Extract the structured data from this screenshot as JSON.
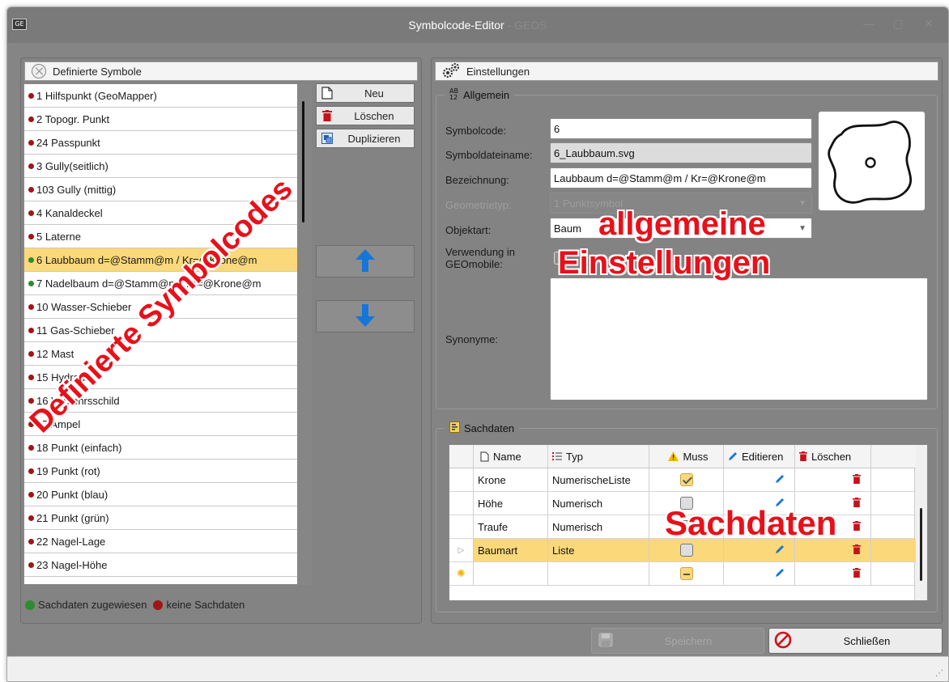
{
  "window": {
    "app_badge": "GE",
    "title": "Symbolcode-Editor",
    "title_suffix": "- GEOS"
  },
  "left_panel": {
    "title": "Definierte Symbole",
    "items": [
      {
        "label": "1 Hilfspunkt (GeoMapper)",
        "color": "#a01515",
        "selected": false
      },
      {
        "label": "2 Topogr. Punkt",
        "color": "#a01515",
        "selected": false
      },
      {
        "label": "24 Passpunkt",
        "color": "#a01515",
        "selected": false
      },
      {
        "label": "3 Gully(seitlich)",
        "color": "#a01515",
        "selected": false
      },
      {
        "label": "103 Gully (mittig)",
        "color": "#a01515",
        "selected": false
      },
      {
        "label": "4 Kanaldeckel",
        "color": "#a01515",
        "selected": false
      },
      {
        "label": "5 Laterne",
        "color": "#a01515",
        "selected": false
      },
      {
        "label": "6 Laubbaum d=@Stamm@m / Kr=@Krone@m",
        "color": "#2e8b2e",
        "selected": true
      },
      {
        "label": "7 Nadelbaum  d=@Stamm@m / Kr=@Krone@m",
        "color": "#2e8b2e",
        "selected": false
      },
      {
        "label": "10 Wasser-Schieber",
        "color": "#a01515",
        "selected": false
      },
      {
        "label": "11 Gas-Schieber",
        "color": "#a01515",
        "selected": false
      },
      {
        "label": "12 Mast",
        "color": "#a01515",
        "selected": false
      },
      {
        "label": "15 Hydrant",
        "color": "#a01515",
        "selected": false
      },
      {
        "label": "16 Verkehrsschild",
        "color": "#a01515",
        "selected": false
      },
      {
        "label": "17 Ampel",
        "color": "#a01515",
        "selected": false
      },
      {
        "label": "18 Punkt (einfach)",
        "color": "#a01515",
        "selected": false
      },
      {
        "label": "19 Punkt (rot)",
        "color": "#a01515",
        "selected": false
      },
      {
        "label": "20 Punkt (blau)",
        "color": "#a01515",
        "selected": false
      },
      {
        "label": "21 Punkt (grün)",
        "color": "#a01515",
        "selected": false
      },
      {
        "label": "22 Nagel-Lage",
        "color": "#a01515",
        "selected": false
      },
      {
        "label": "23 Nagel-Höhe",
        "color": "#a01515",
        "selected": false
      }
    ],
    "buttons": {
      "new": "Neu",
      "delete": "Löschen",
      "duplicate": "Duplizieren"
    },
    "legend": {
      "assigned": "Sachdaten zugewiesen",
      "assigned_color": "#2e8b2e",
      "none": "keine Sachdaten",
      "none_color": "#a01515"
    }
  },
  "right_panel": {
    "title": "Einstellungen",
    "general": {
      "title": "Allgemein",
      "symbolcode_label": "Symbolcode:",
      "symbolcode_value": "6",
      "file_label": "Symboldateiname:",
      "file_value": "6_Laubbaum.svg",
      "name_label": "Bezeichnung:",
      "name_value": "Laubbaum d=@Stamm@m / Kr=@Krone@m",
      "geom_label": "Geometrietyp:",
      "geom_value": "1 Punktsymbol",
      "object_label": "Objektart:",
      "object_value": "Baum",
      "usage_label_1": "Verwendung in",
      "usage_label_2": "GEOmobile:",
      "synonyms_label": "Synonyme:",
      "synonyms_value": ""
    },
    "attributes": {
      "title": "Sachdaten",
      "columns": [
        "Name",
        "Typ",
        "Muss",
        "Editieren",
        "Löschen"
      ],
      "rows": [
        {
          "name": "Krone",
          "type": "NumerischeListe",
          "required": "checked",
          "selected": false
        },
        {
          "name": "Höhe",
          "type": "Numerisch",
          "required": "unchecked",
          "selected": false
        },
        {
          "name": "Traufe",
          "type": "Numerisch",
          "required": "unchecked",
          "selected": false
        },
        {
          "name": "Baumart",
          "type": "Liste",
          "required": "unchecked",
          "selected": true
        },
        {
          "name": "",
          "type": "",
          "required": "indeterminate",
          "selected": false
        }
      ]
    }
  },
  "footer": {
    "save": "Speichern",
    "close": "Schließen"
  },
  "annotations": {
    "left": "Definierte Symbolcodes",
    "general": "allgemeine Einstellungen",
    "attributes": "Sachdaten",
    "color": "#e8101a"
  }
}
